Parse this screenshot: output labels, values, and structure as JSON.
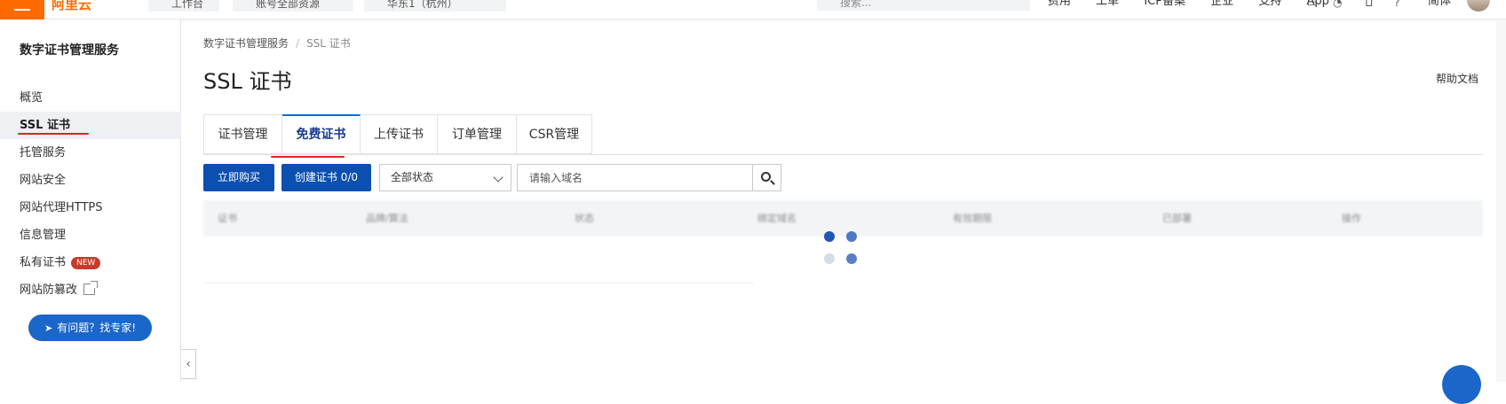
{
  "topbar": {
    "logo": "阿里云",
    "nav_buttons": [
      "工作台",
      "账号全部资源",
      "华东1（杭州）"
    ],
    "search_placeholder": "搜索...",
    "links": [
      "费用",
      "工单",
      "ICP备案",
      "企业",
      "支持",
      "App"
    ],
    "icons": [
      "terminal-icon",
      "bell-icon",
      "cart-icon",
      "help-icon"
    ],
    "language": "简体"
  },
  "sidebar": {
    "title": "数字证书管理服务",
    "items": [
      {
        "label": "概览"
      },
      {
        "label": "SSL 证书"
      },
      {
        "label": "托管服务"
      },
      {
        "label": "网站安全"
      },
      {
        "label": "网站代理HTTPS"
      },
      {
        "label": "信息管理"
      },
      {
        "label": "私有证书",
        "badge": "NEW"
      },
      {
        "label": "网站防篡改"
      }
    ],
    "expert_button": "有问题？找专家!"
  },
  "breadcrumb": {
    "root": "数字证书管理服务",
    "separator": "/",
    "current": "SSL 证书"
  },
  "page": {
    "title": "SSL 证书",
    "help_link": "帮助文档"
  },
  "tabs": [
    {
      "label": "证书管理"
    },
    {
      "label": "免费证书"
    },
    {
      "label": "上传证书"
    },
    {
      "label": "订单管理"
    },
    {
      "label": "CSR管理"
    }
  ],
  "toolbar": {
    "buy_now": "立即购买",
    "create_cert": "创建证书 0/0",
    "status_select": "全部状态",
    "search_placeholder": "请输入域名"
  },
  "table": {
    "headers": [
      "证书",
      "品牌/算法",
      "状态",
      "绑定域名",
      "有效期限",
      "已部署",
      "操作"
    ]
  },
  "colors": {
    "primary": "#0b4fb0",
    "brand_orange": "#ff6a00",
    "annotation_red": "#e0212a",
    "active_tab": "#0070cc"
  }
}
